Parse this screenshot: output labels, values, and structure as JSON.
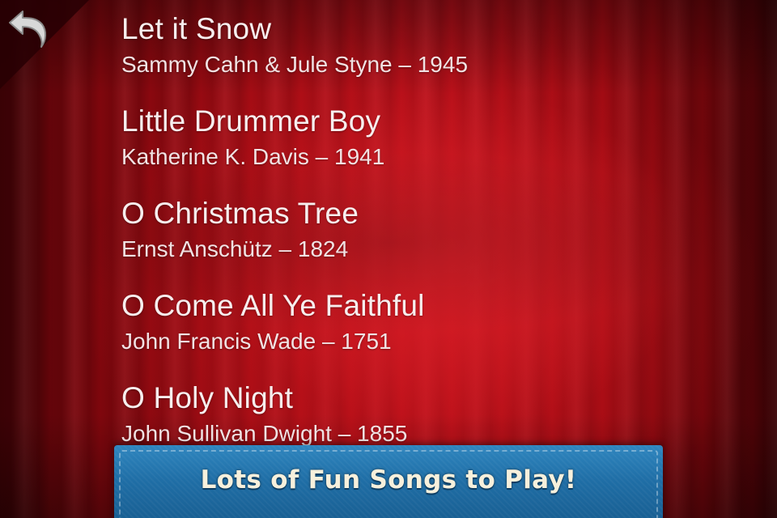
{
  "back": {
    "icon": "back-arrow-icon"
  },
  "songs": [
    {
      "title": "Let it Snow",
      "credit": "Sammy Cahn & Jule Styne – 1945"
    },
    {
      "title": "Little Drummer Boy",
      "credit": "Katherine K. Davis – 1941"
    },
    {
      "title": "O Christmas Tree",
      "credit": "Ernst Anschütz – 1824"
    },
    {
      "title": "O Come All Ye Faithful",
      "credit": "John Francis Wade – 1751"
    },
    {
      "title": "O Holy Night",
      "credit": "John Sullivan Dwight – 1855"
    }
  ],
  "banner": {
    "text": "Lots of Fun Songs to Play!",
    "color": "#2277b0"
  },
  "colors": {
    "curtain": "#b8101a",
    "text": "#f7eeee"
  }
}
